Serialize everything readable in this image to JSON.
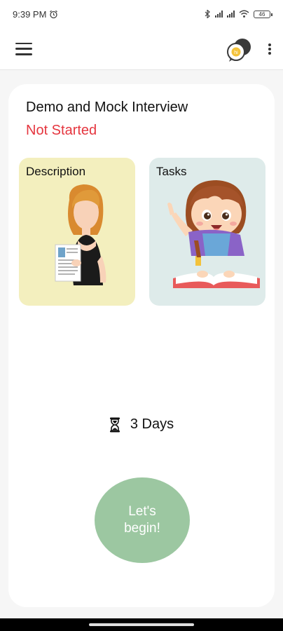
{
  "status_bar": {
    "time": "9:39 PM",
    "battery": "46"
  },
  "app_bar": {
    "menu_icon": "hamburger-menu-icon",
    "chat_icon": "chat-bubble-icon",
    "more_icon": "more-vert-icon"
  },
  "card": {
    "title": "Demo and Mock Interview",
    "status": "Not Started",
    "status_color": "#e5363f",
    "tiles": [
      {
        "label": "Description",
        "bg": "#f3efbe"
      },
      {
        "label": "Tasks",
        "bg": "#deebea"
      }
    ],
    "duration": "3 Days",
    "duration_icon": "hourglass-icon",
    "begin_label": "Let's begin!",
    "begin_color": "#9cc7a1"
  }
}
